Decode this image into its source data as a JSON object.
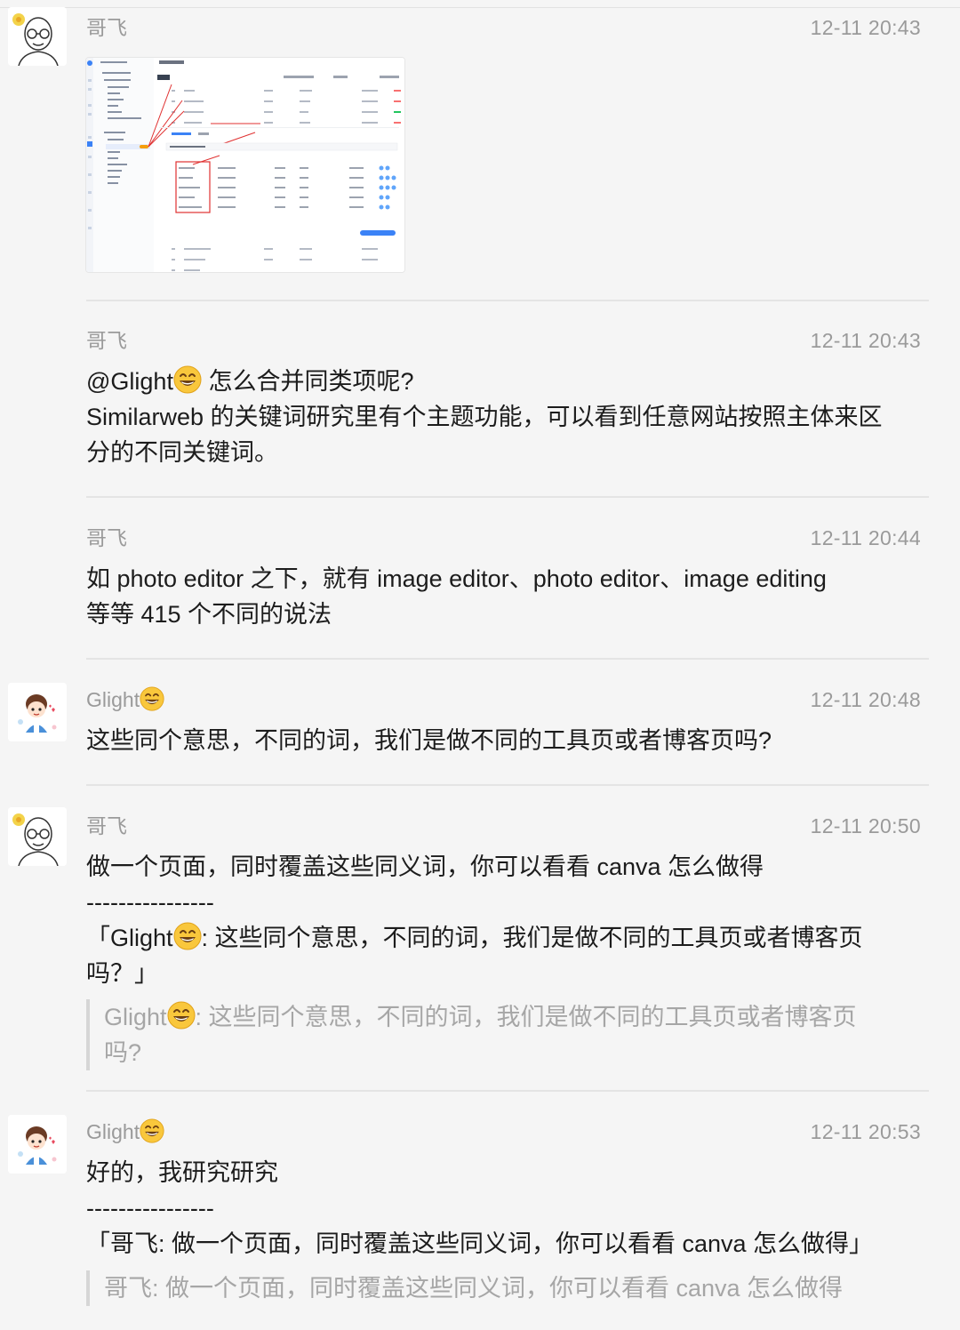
{
  "messages": [
    {
      "sender": "哥飞",
      "time": "12-11 20:43",
      "avatar": "bald-man-glasses-avatar",
      "type": "image"
    },
    {
      "sender": "哥飞",
      "time": "12-11 20:43",
      "mention": "@Glight",
      "line1_rest": " 怎么合并同类项呢?",
      "line2": "Similarweb 的关键词研究里有个主题功能，可以看到任意网站按照主体来区",
      "line3": "分的不同关键词。"
    },
    {
      "sender": "哥飞",
      "time": "12-11 20:44",
      "line1": "如 photo editor 之下，就有 image editor、photo editor、image editing",
      "line2": "等等 415 个不同的说法"
    },
    {
      "sender": "Glight",
      "time": "12-11 20:48",
      "avatar": "cartoon-boy-avatar",
      "line1": "这些同个意思，不同的词，我们是做不同的工具页或者博客页吗?"
    },
    {
      "sender": "哥飞",
      "time": "12-11 20:50",
      "line1": "做一个页面，同时覆盖这些同义词，你可以看看 canva 怎么做得",
      "dashes": "----------------",
      "quote_open": "「Glight",
      "quote_line1_rest": ": 这些同个意思，不同的词，我们是做不同的工具页或者博客页",
      "quote_line2": "吗？」",
      "ref_name": "Glight",
      "ref_line1_rest": ": 这些同个意思，不同的词，我们是做不同的工具页或者博客页",
      "ref_line2": "吗?"
    },
    {
      "sender": "Glight",
      "time": "12-11 20:53",
      "line1": "好的，我研究研究",
      "dashes": "----------------",
      "quote": "「哥飞: 做一个页面，同时覆盖这些同义词，你可以看看 canva 怎么做得」",
      "ref": "哥飞: 做一个页面，同时覆盖这些同义词，你可以看看 canva 怎么做得"
    }
  ],
  "screenshot": {
    "tab": "canva.com",
    "title": "主题",
    "rows_top": [
      "Canva",
      "Canva Login",
      "Canva Affinity",
      "Photo Editor"
    ],
    "subtab1": "关键词",
    "subtab2": "趋势",
    "keywords": [
      "photo editor",
      "image editor",
      "edit image online",
      "photo editing",
      "online photo editor"
    ],
    "rows_bottom": [
      "Capcut Video Editor",
      "Canva & Tools",
      "PDF Editor"
    ]
  },
  "colors": {
    "background": "#f5f5f5",
    "meta_text": "#9a9a9a",
    "quote_text": "#a6a6a6"
  }
}
